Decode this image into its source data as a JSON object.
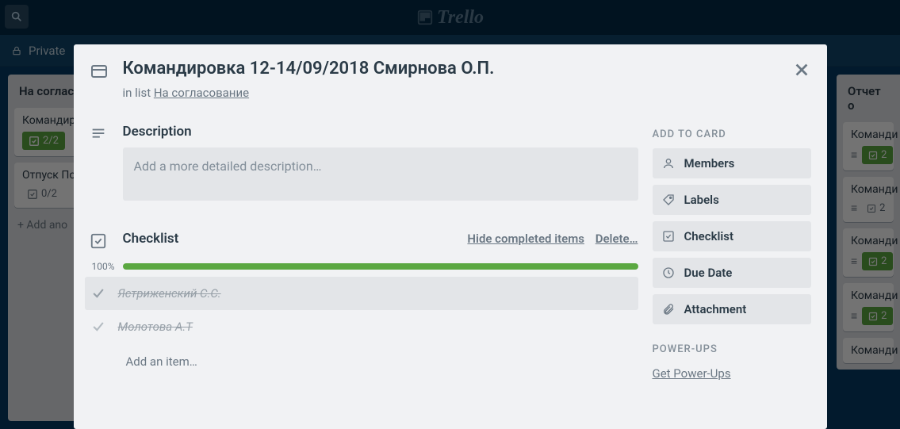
{
  "header": {
    "brand": "Trello",
    "visibility": "Private"
  },
  "board": {
    "left_list": {
      "title": "На соглас",
      "cards": [
        {
          "title": "Командировка Смирнова",
          "badge": "2/2",
          "badge_green": true
        },
        {
          "title": "Отпуск По",
          "badge": "0/2",
          "badge_green": false
        }
      ],
      "add": "Add ano"
    },
    "right_list": {
      "title": "Отчет о",
      "cards": [
        {
          "title": "Команди",
          "badge": "2",
          "badge_green": true,
          "desc": true
        },
        {
          "title": "Команди",
          "badge": "2",
          "badge_green": false,
          "desc": true
        },
        {
          "title": "Команди",
          "badge": "2",
          "badge_green": true,
          "desc": true
        },
        {
          "title": "Команди",
          "badge": "2",
          "badge_green": true,
          "desc": true
        },
        {
          "title": "Команди",
          "badge": "",
          "badge_green": false,
          "desc": false
        }
      ]
    }
  },
  "modal": {
    "title": "Командировка 12-14/09/2018 Смирнова О.П.",
    "in_list_prefix": "in list",
    "in_list_name": "На согласование",
    "description_label": "Description",
    "description_placeholder": "Add a more detailed description…",
    "checklist_label": "Checklist",
    "hide_completed": "Hide completed items",
    "delete": "Delete…",
    "progress_pct": "100%",
    "items": [
      {
        "text": "Ястриженский С.С.",
        "done": true
      },
      {
        "text": "Молотова А.Т",
        "done": true
      }
    ],
    "add_item": "Add an item…",
    "sidebar": {
      "add_to_card": "ADD TO CARD",
      "members": "Members",
      "labels": "Labels",
      "checklist": "Checklist",
      "due_date": "Due Date",
      "attachment": "Attachment",
      "powerups": "POWER-UPS",
      "get_powerups": "Get Power-Ups"
    }
  }
}
